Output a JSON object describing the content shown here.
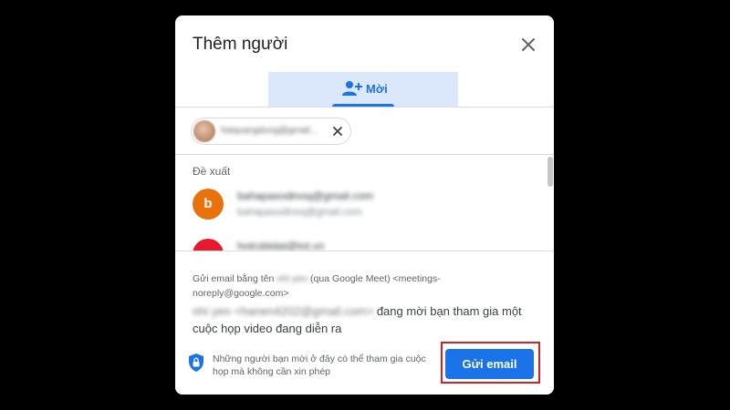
{
  "dialog": {
    "title": "Thêm người",
    "tab_label": "Mời",
    "chip": {
      "text": "haiquangdung@gmail..."
    },
    "suggestions_label": "Đề xuất",
    "contacts": [
      {
        "initial": "b",
        "color": "#e8710a",
        "name": "bahapasodinoq@gmail.com",
        "email": "bahapasodinoq@gmail.com"
      },
      {
        "initial": "",
        "color": "#e8192c",
        "name": "hotrobtdat@tot.vn",
        "email": ""
      }
    ],
    "info": {
      "prefix": "Gửi email bằng tên ",
      "sender_name": "nhi yen",
      "via": " (qua Google Meet) <meetings-noreply@google.com>"
    },
    "message": {
      "sender_email": "nhi yen <hanen4202@gmail.com>",
      "text": " đang mời bạn tham gia một cuộc họp video đang diễn ra"
    },
    "note": "Những người bạn mời ở đây có thể tham gia cuộc họp mà không cần xin phép",
    "send_label": "Gửi email"
  }
}
